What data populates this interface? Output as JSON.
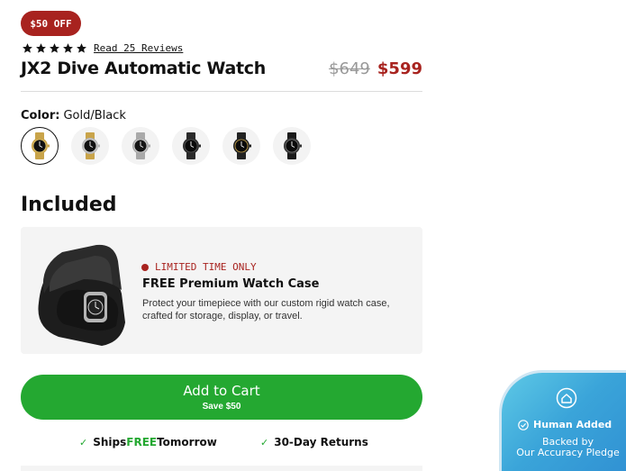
{
  "badge": {
    "label": "$50 OFF",
    "color": "#a8231f"
  },
  "rating": {
    "stars": 5,
    "reviews_link": "Read 25 Reviews"
  },
  "product": {
    "title": "JX2 Dive Automatic Watch",
    "price_original": "$649",
    "price_sale": "$599"
  },
  "color_option": {
    "label": "Color:",
    "selected": "Gold/Black"
  },
  "swatches": [
    {
      "name": "gold-black",
      "case": "#c9a44a",
      "dial": "#111111",
      "strap": "#c9a44a",
      "accent": "#e0c46a"
    },
    {
      "name": "two-tone",
      "case": "#b8b8b8",
      "dial": "#111111",
      "strap": "#c9a44a",
      "accent": "#d9d9d9"
    },
    {
      "name": "silver-black",
      "case": "#a9a9a9",
      "dial": "#151515",
      "strap": "#a9a9a9",
      "accent": "#dcdcdc"
    },
    {
      "name": "all-black",
      "case": "#2a2a2a",
      "dial": "#0a0a0a",
      "strap": "#2a2a2a",
      "accent": "#555555"
    },
    {
      "name": "black-gold",
      "case": "#222222",
      "dial": "#0a0a0a",
      "strap": "#222222",
      "accent": "#c9a44a"
    },
    {
      "name": "black-rubber",
      "case": "#333333",
      "dial": "#0a0a0a",
      "strap": "#1a1a1a",
      "accent": "#777777"
    }
  ],
  "included": {
    "heading": "Included",
    "tag": "LIMITED TIME ONLY",
    "title": "FREE Premium Watch Case",
    "description": "Protect your timepiece with our custom rigid watch case, crafted for storage, display, or travel."
  },
  "cart": {
    "label": "Add to Cart",
    "sublabel": "Save $50",
    "color": "#24a831"
  },
  "perks": {
    "shipping_pre": "Ships ",
    "shipping_free": "FREE",
    "shipping_post": " Tomorrow",
    "returns": "30-Day Returns"
  },
  "pledge": {
    "title": "Human Added",
    "line1": "Backed by",
    "line2": "Our Accuracy Pledge"
  }
}
